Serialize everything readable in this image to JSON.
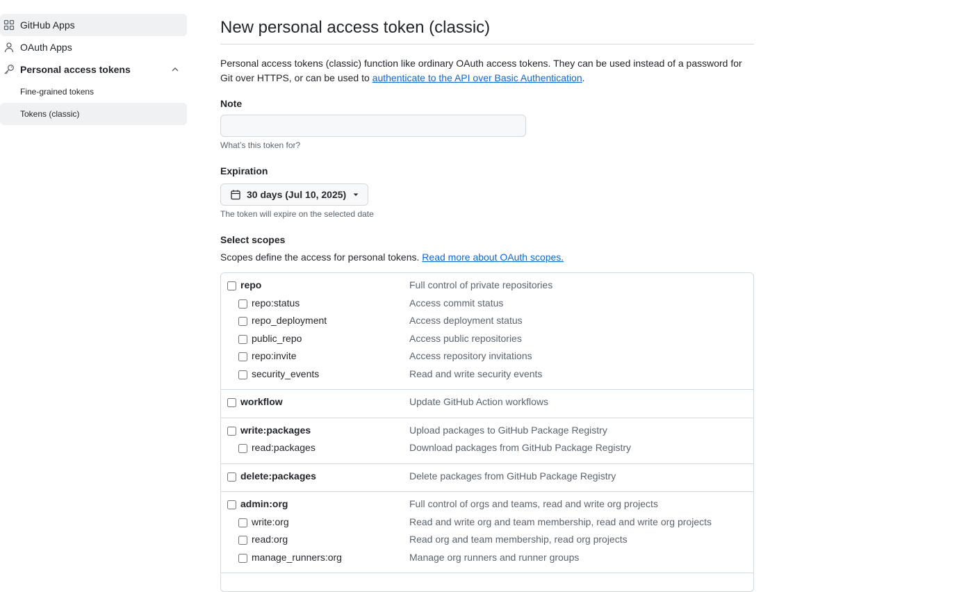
{
  "sidebar": {
    "items": [
      {
        "label": "GitHub Apps",
        "icon": "apps-grid-icon"
      },
      {
        "label": "OAuth Apps",
        "icon": "person-icon"
      },
      {
        "label": "Personal access tokens",
        "icon": "key-icon",
        "expanded": true
      },
      {
        "label": "Fine-grained tokens"
      },
      {
        "label": "Tokens (classic)",
        "selected": true
      }
    ]
  },
  "main": {
    "title": "New personal access token (classic)",
    "intro_text": "Personal access tokens (classic) function like ordinary OAuth access tokens. They can be used instead of a password for Git over HTTPS, or can be used to ",
    "intro_link": "authenticate to the API over Basic Authentication",
    "intro_end": ".",
    "note": {
      "label": "Note",
      "value": "",
      "hint": "What’s this token for?"
    },
    "expiration": {
      "label": "Expiration",
      "selected": "30 days (Jul 10, 2025)",
      "hint": "The token will expire on the selected date"
    },
    "scopes": {
      "label": "Select scopes",
      "description": "Scopes define the access for personal tokens.",
      "link": "Read more about OAuth scopes.",
      "groups": [
        {
          "name": "repo",
          "desc": "Full control of private repositories",
          "children": [
            {
              "name": "repo:status",
              "desc": "Access commit status"
            },
            {
              "name": "repo_deployment",
              "desc": "Access deployment status"
            },
            {
              "name": "public_repo",
              "desc": "Access public repositories"
            },
            {
              "name": "repo:invite",
              "desc": "Access repository invitations"
            },
            {
              "name": "security_events",
              "desc": "Read and write security events"
            }
          ]
        },
        {
          "name": "workflow",
          "desc": "Update GitHub Action workflows",
          "children": []
        },
        {
          "name": "write:packages",
          "desc": "Upload packages to GitHub Package Registry",
          "children": [
            {
              "name": "read:packages",
              "desc": "Download packages from GitHub Package Registry"
            }
          ]
        },
        {
          "name": "delete:packages",
          "desc": "Delete packages from GitHub Package Registry",
          "children": []
        },
        {
          "name": "admin:org",
          "desc": "Full control of orgs and teams, read and write org projects",
          "children": [
            {
              "name": "write:org",
              "desc": "Read and write org and team membership, read and write org projects"
            },
            {
              "name": "read:org",
              "desc": "Read org and team membership, read org projects"
            },
            {
              "name": "manage_runners:org",
              "desc": "Manage org runners and runner groups"
            }
          ]
        }
      ]
    }
  },
  "colors": {
    "link": "#0969da",
    "text": "#1f2328",
    "muted": "#59636e",
    "border": "#d1d9e0",
    "active_bg": "#eff1f3"
  }
}
